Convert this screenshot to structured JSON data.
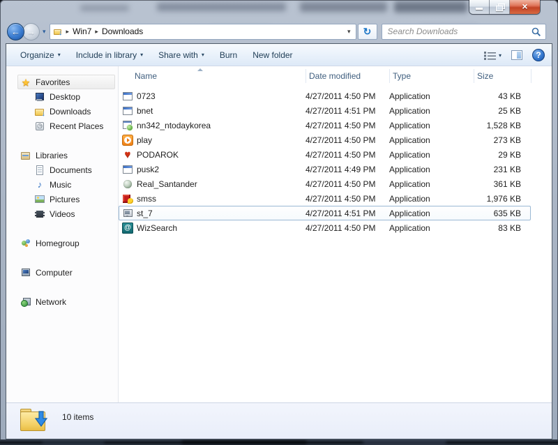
{
  "navbar": {
    "breadcrumb": {
      "crumbs": [
        "Win7",
        "Downloads"
      ]
    },
    "search": {
      "placeholder": "Search Downloads"
    }
  },
  "toolbar": {
    "items": [
      {
        "label": "Organize",
        "dropdown": true
      },
      {
        "label": "Include in library",
        "dropdown": true
      },
      {
        "label": "Share with",
        "dropdown": true
      },
      {
        "label": "Burn",
        "dropdown": false
      },
      {
        "label": "New folder",
        "dropdown": false
      }
    ]
  },
  "sidebar": {
    "sections": [
      {
        "items": [
          {
            "label": "Favorites",
            "icon": "star",
            "level": 0,
            "highlight": true
          },
          {
            "label": "Desktop",
            "icon": "desktop",
            "level": 1
          },
          {
            "label": "Downloads",
            "icon": "dlfolder",
            "level": 1
          },
          {
            "label": "Recent Places",
            "icon": "recent",
            "level": 1
          }
        ]
      },
      {
        "items": [
          {
            "label": "Libraries",
            "icon": "lib",
            "level": 0
          },
          {
            "label": "Documents",
            "icon": "doc",
            "level": 1
          },
          {
            "label": "Music",
            "icon": "music",
            "level": 1
          },
          {
            "label": "Pictures",
            "icon": "pic",
            "level": 1
          },
          {
            "label": "Videos",
            "icon": "vid",
            "level": 1
          }
        ]
      },
      {
        "items": [
          {
            "label": "Homegroup",
            "icon": "home",
            "level": 0
          }
        ]
      },
      {
        "items": [
          {
            "label": "Computer",
            "icon": "comp",
            "level": 0
          }
        ]
      },
      {
        "items": [
          {
            "label": "Network",
            "icon": "net",
            "level": 0
          }
        ]
      }
    ]
  },
  "files": {
    "columns": [
      "Name",
      "Date modified",
      "Type",
      "Size"
    ],
    "sort": {
      "column": "Name",
      "direction": "ascending"
    },
    "rows": [
      {
        "icon": "app",
        "name": "0723",
        "date": "4/27/2011 4:50 PM",
        "type": "Application",
        "size": "43 KB",
        "selected": false
      },
      {
        "icon": "app",
        "name": "bnet",
        "date": "4/27/2011 4:51 PM",
        "type": "Application",
        "size": "25 KB",
        "selected": false
      },
      {
        "icon": "installer",
        "name": "nn342_ntodaykorea",
        "date": "4/27/2011 4:50 PM",
        "type": "Application",
        "size": "1,528 KB",
        "selected": false
      },
      {
        "icon": "play",
        "name": "play",
        "date": "4/27/2011 4:50 PM",
        "type": "Application",
        "size": "273 KB",
        "selected": false
      },
      {
        "icon": "heart",
        "name": "PODAROK",
        "date": "4/27/2011 4:50 PM",
        "type": "Application",
        "size": "29 KB",
        "selected": false
      },
      {
        "icon": "app",
        "name": "pusk2",
        "date": "4/27/2011 4:49 PM",
        "type": "Application",
        "size": "231 KB",
        "selected": false
      },
      {
        "icon": "globe",
        "name": "Real_Santander",
        "date": "4/27/2011 4:50 PM",
        "type": "Application",
        "size": "361 KB",
        "selected": false
      },
      {
        "icon": "game",
        "name": "smss",
        "date": "4/27/2011 4:50 PM",
        "type": "Application",
        "size": "1,976 KB",
        "selected": false
      },
      {
        "icon": "setup",
        "name": "st_7",
        "date": "4/27/2011 4:51 PM",
        "type": "Application",
        "size": "635 KB",
        "selected": true
      },
      {
        "icon": "at",
        "name": "WizSearch",
        "date": "4/27/2011 4:50 PM",
        "type": "Application",
        "size": "83 KB",
        "selected": false
      }
    ]
  },
  "status": {
    "text": "10 items"
  },
  "colors": {
    "close_button_red": "#c24325",
    "selection_border": "#9ab8d4",
    "header_text": "#3f5e7e",
    "toolbar_text": "#1e3c55",
    "accent_blue": "#2f72c8"
  }
}
